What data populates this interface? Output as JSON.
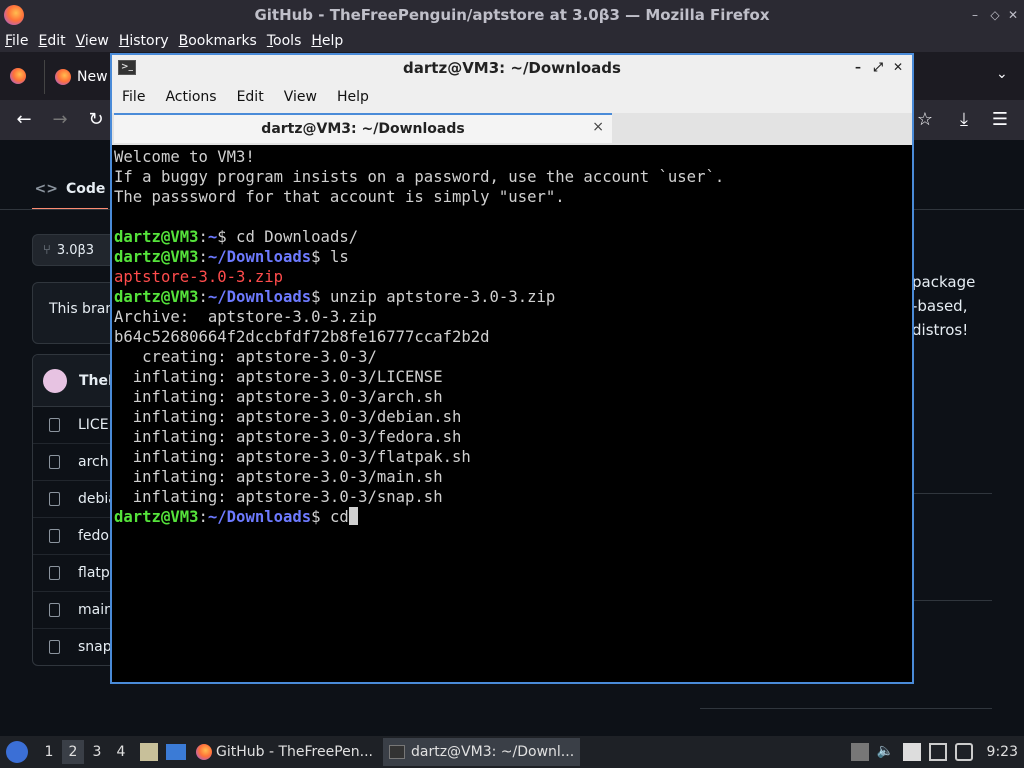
{
  "firefox": {
    "window_title": "GitHub - TheFreePenguin/aptstore at 3.0β3 — Mozilla Firefox",
    "menu": [
      "File",
      "Edit",
      "View",
      "History",
      "Bookmarks",
      "Tools",
      "Help"
    ],
    "tab_label": "New",
    "icons": [
      "firefox-icon",
      "back-icon",
      "forward-icon",
      "reload-icon",
      "star-icon",
      "download-icon",
      "hamburger-menu-icon",
      "chevron-down-icon"
    ]
  },
  "github": {
    "code_tab": "Code",
    "branch": "3.0β3",
    "notice": "This branch",
    "owner": "TheF",
    "files": [
      "LICE",
      "arch.",
      "debia",
      "fedor",
      "flatpa",
      "main",
      "snap"
    ],
    "about": [
      "package",
      "-based,",
      "distros!"
    ]
  },
  "terminal": {
    "title": "dartz@VM3: ~/Downloads",
    "menu": [
      "File",
      "Actions",
      "Edit",
      "View",
      "Help"
    ],
    "tab_label": "dartz@VM3: ~/Downloads",
    "tab_close": "×",
    "lines": {
      "l1": "Welcome to VM3!",
      "l2": "If a buggy program insists on a password, use the account `user`.",
      "l3": "The passsword for that account is simply \"user\".",
      "p1_user": "dartz@VM3",
      "p1_path": "~",
      "p1_cmd": "$ cd Downloads/",
      "p2_user": "dartz@VM3",
      "p2_path": "~/Downloads",
      "p2_cmd": "$ ls",
      "ls_out": "aptstore-3.0-3.zip",
      "p3_user": "dartz@VM3",
      "p3_path": "~/Downloads",
      "p3_cmd": "$ unzip aptstore-3.0-3.zip",
      "o1": "Archive:  aptstore-3.0-3.zip",
      "o2": "b64c52680664f2dccbfdf72b8fe16777ccaf2b2d",
      "o3": "   creating: aptstore-3.0-3/",
      "o4": "  inflating: aptstore-3.0-3/LICENSE",
      "o5": "  inflating: aptstore-3.0-3/arch.sh",
      "o6": "  inflating: aptstore-3.0-3/debian.sh",
      "o7": "  inflating: aptstore-3.0-3/fedora.sh",
      "o8": "  inflating: aptstore-3.0-3/flatpak.sh",
      "o9": "  inflating: aptstore-3.0-3/main.sh",
      "o10": "  inflating: aptstore-3.0-3/snap.sh",
      "p4_user": "dartz@VM3",
      "p4_path": "~/Downloads",
      "p4_cmd": "$ cd"
    },
    "colors": {
      "prompt_user": "#55e33b",
      "prompt_path": "#6d7aff",
      "archive": "#ff4c4c"
    }
  },
  "taskbar": {
    "workspaces": [
      "1",
      "2",
      "3",
      "4"
    ],
    "active_workspace": "2",
    "tasks": [
      "GitHub - TheFreePen...",
      "dartz@VM3: ~/Downl..."
    ],
    "clock": "9:23"
  }
}
